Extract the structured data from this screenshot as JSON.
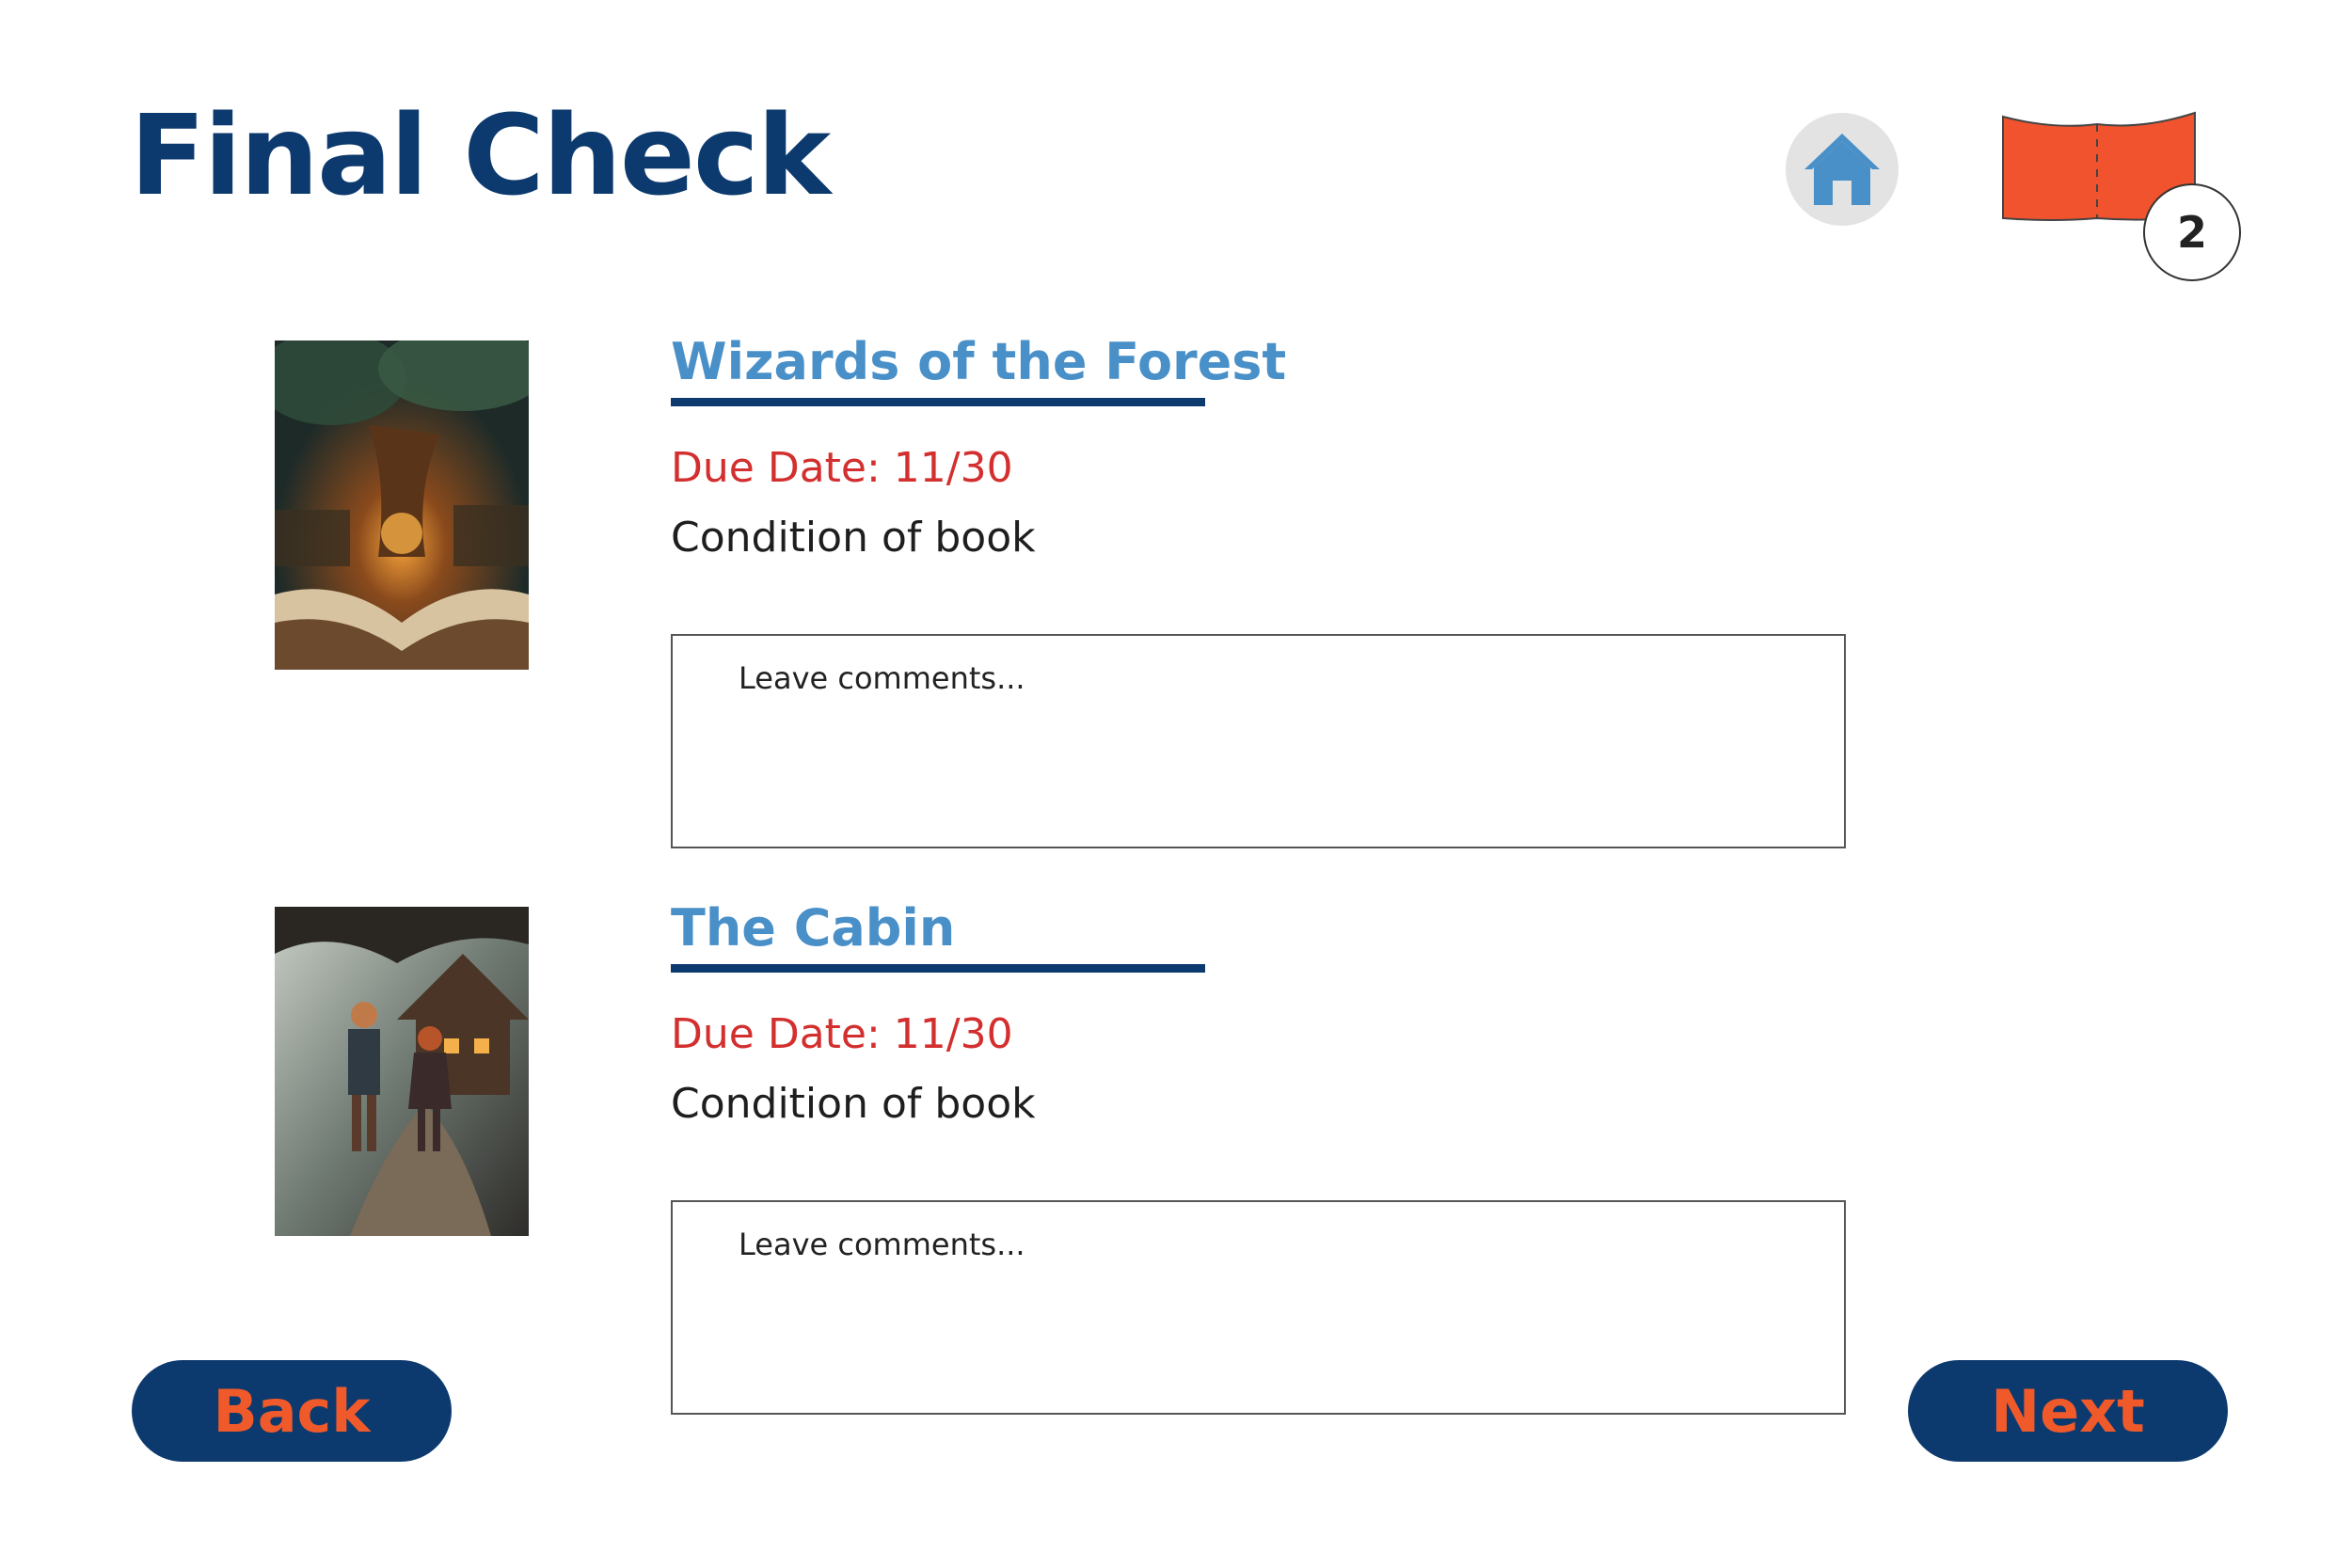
{
  "page": {
    "title": "Final Check",
    "cart_count": "2"
  },
  "books": [
    {
      "title": "Wizards of the Forest",
      "due_date": "Due Date: 11/30",
      "condition_label": "Condition of book",
      "comments_placeholder": "Leave comments...",
      "cover": "enchanted-tree-open-book-cover"
    },
    {
      "title": "The Cabin",
      "due_date": "Due Date: 11/30",
      "condition_label": "Condition of book",
      "comments_placeholder": "Leave comments...",
      "cover": "children-walking-to-cabin-cover"
    }
  ],
  "nav": {
    "back_label": "Back",
    "next_label": "Next"
  },
  "colors": {
    "title": "#0d3a6e",
    "book_title": "#4a90c8",
    "due_date": "#d32f2f",
    "cart": "#f0532d",
    "button_bg": "#0d3a6e",
    "button_text": "#f05a2a",
    "home_icon": "#4a90c8"
  },
  "icons": {
    "home": "home-icon",
    "cart": "book-cart-icon"
  }
}
